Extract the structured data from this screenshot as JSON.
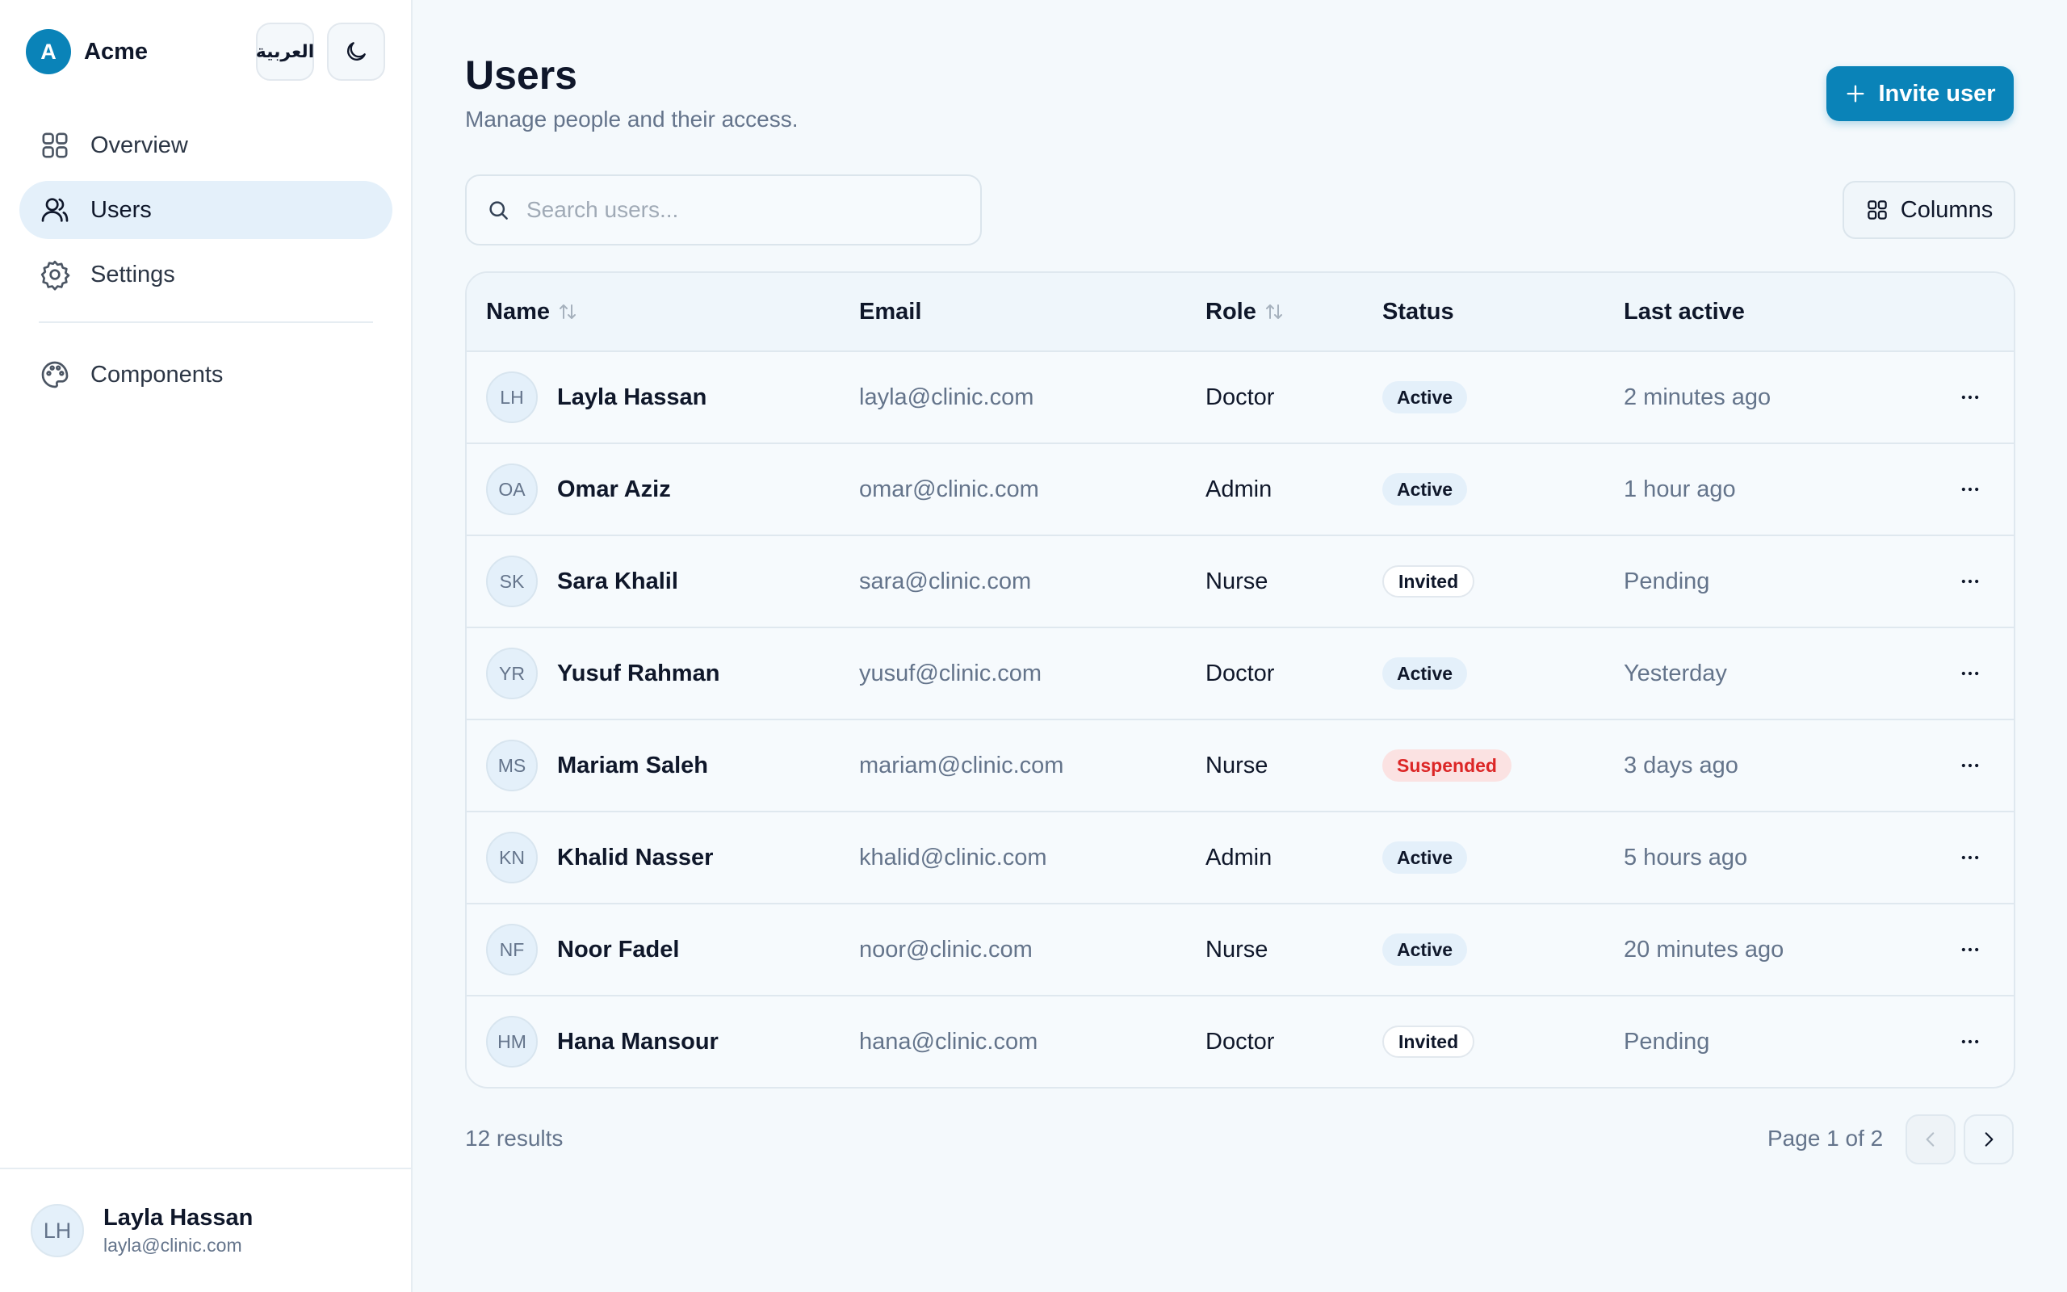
{
  "brand": {
    "logo_letter": "A",
    "name": "Acme"
  },
  "header_actions": {
    "language_label": "العربية",
    "theme_icon": "moon-icon"
  },
  "sidebar": {
    "items": [
      {
        "label": "Overview",
        "icon": "grid-icon",
        "active": false
      },
      {
        "label": "Users",
        "icon": "users-icon",
        "active": true
      },
      {
        "label": "Settings",
        "icon": "gear-icon",
        "active": false
      },
      {
        "label": "Components",
        "icon": "palette-icon",
        "active": false
      }
    ],
    "current_user": {
      "initials": "LH",
      "name": "Layla Hassan",
      "email": "layla@clinic.com"
    }
  },
  "main": {
    "title": "Users",
    "subtitle": "Manage people and their access.",
    "invite_label": "Invite user",
    "search_placeholder": "Search users...",
    "columns_label": "Columns"
  },
  "table": {
    "headers": {
      "name": "Name",
      "email": "Email",
      "role": "Role",
      "status": "Status",
      "last_active": "Last active"
    },
    "rows": [
      {
        "initials": "LH",
        "name": "Layla Hassan",
        "email": "layla@clinic.com",
        "role": "Doctor",
        "status": "Active",
        "last_active": "2 minutes ago"
      },
      {
        "initials": "OA",
        "name": "Omar Aziz",
        "email": "omar@clinic.com",
        "role": "Admin",
        "status": "Active",
        "last_active": "1 hour ago"
      },
      {
        "initials": "SK",
        "name": "Sara Khalil",
        "email": "sara@clinic.com",
        "role": "Nurse",
        "status": "Invited",
        "last_active": "Pending"
      },
      {
        "initials": "YR",
        "name": "Yusuf Rahman",
        "email": "yusuf@clinic.com",
        "role": "Doctor",
        "status": "Active",
        "last_active": "Yesterday"
      },
      {
        "initials": "MS",
        "name": "Mariam Saleh",
        "email": "mariam@clinic.com",
        "role": "Nurse",
        "status": "Suspended",
        "last_active": "3 days ago"
      },
      {
        "initials": "KN",
        "name": "Khalid Nasser",
        "email": "khalid@clinic.com",
        "role": "Admin",
        "status": "Active",
        "last_active": "5 hours ago"
      },
      {
        "initials": "NF",
        "name": "Noor Fadel",
        "email": "noor@clinic.com",
        "role": "Nurse",
        "status": "Active",
        "last_active": "20 minutes ago"
      },
      {
        "initials": "HM",
        "name": "Hana Mansour",
        "email": "hana@clinic.com",
        "role": "Doctor",
        "status": "Invited",
        "last_active": "Pending"
      }
    ]
  },
  "pagination": {
    "results": "12 results",
    "page_info": "Page 1 of 2"
  },
  "colors": {
    "accent": "#0a83b8",
    "active_nav": "#e4f0fa",
    "suspended": "#dc2626",
    "background": "#f4f9fc"
  }
}
